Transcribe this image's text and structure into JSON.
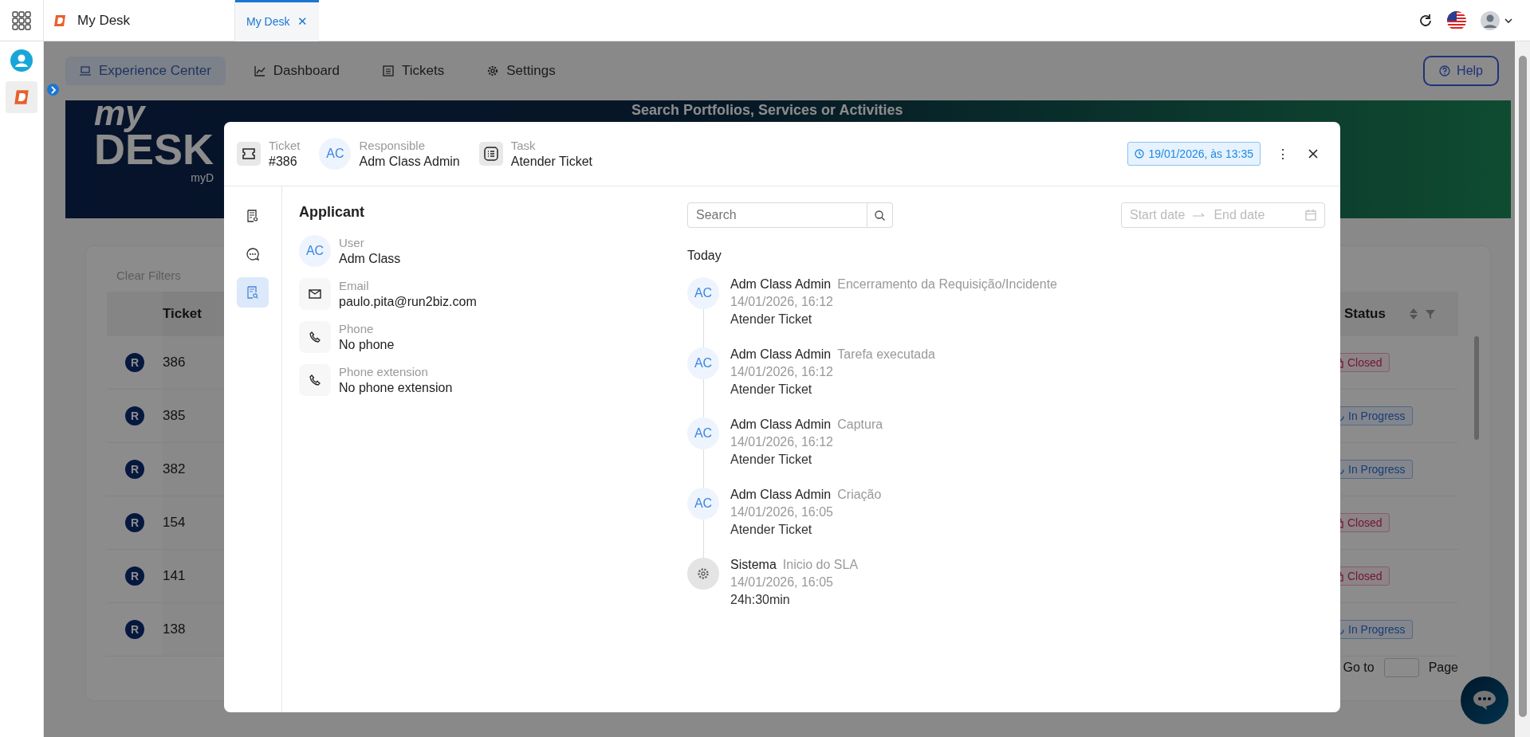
{
  "app_bar": {
    "title": "My Desk",
    "tabs": [
      {
        "label": "My Desk",
        "selected": true,
        "close": "✕"
      }
    ]
  },
  "nav": {
    "items": [
      {
        "label": "Experience Center",
        "selected": true
      },
      {
        "label": "Dashboard",
        "selected": false
      },
      {
        "label": "Tickets",
        "selected": false
      },
      {
        "label": "Settings",
        "selected": false
      }
    ],
    "help": "Help"
  },
  "banner": {
    "logo_top": "my",
    "logo_main": "DESK",
    "logo_sub": "myD",
    "heading": "Search Portfolios, Services or Activities"
  },
  "table": {
    "clear_filters": "Clear Filters",
    "columns": [
      "Ticket",
      "Status"
    ],
    "rows": [
      {
        "badge": "R",
        "ticket": "386",
        "status": "Closed",
        "kind": "closed"
      },
      {
        "badge": "R",
        "ticket": "385",
        "status": "In Progress",
        "kind": "progress"
      },
      {
        "badge": "R",
        "ticket": "382",
        "status": "In Progress",
        "kind": "progress"
      },
      {
        "badge": "R",
        "ticket": "154",
        "status": "Closed",
        "kind": "closed"
      },
      {
        "badge": "R",
        "ticket": "141",
        "status": "Closed",
        "kind": "closed"
      },
      {
        "badge": "R",
        "ticket": "138",
        "status": "In Progress",
        "kind": "progress"
      }
    ],
    "pagination": {
      "go_to": "Go to",
      "page": "Page"
    }
  },
  "modal": {
    "header": {
      "ticket_label": "Ticket",
      "ticket": "#386",
      "responsible_label": "Responsible",
      "responsible_initials": "AC",
      "responsible": "Adm Class Admin",
      "task_label": "Task",
      "task": "Atender Ticket",
      "date": "19/01/2026, às 13:35",
      "menu": "⋮"
    },
    "side_tabs": [
      {
        "selected": false
      },
      {
        "selected": false
      },
      {
        "selected": true
      }
    ],
    "applicant": {
      "title": "Applicant",
      "fields": [
        {
          "kind": "avatar",
          "initials": "AC",
          "label": "User",
          "value": "Adm Class"
        },
        {
          "kind": "email",
          "label": "Email",
          "value": "paulo.pita@run2biz.com"
        },
        {
          "kind": "phone",
          "label": "Phone",
          "value": "No phone"
        },
        {
          "kind": "phone",
          "label": "Phone extension",
          "value": "No phone extension"
        }
      ]
    },
    "search": {
      "placeholder": "Search"
    },
    "date_range": {
      "start": "Start date",
      "end": "End date"
    },
    "timeline": {
      "group": "Today",
      "events": [
        {
          "kind": "user",
          "initials": "AC",
          "name": "Adm Class Admin",
          "action": "Encerramento da Requisição/Incidente",
          "time": "14/01/2026, 16:12",
          "detail": "Atender Ticket"
        },
        {
          "kind": "user",
          "initials": "AC",
          "name": "Adm Class Admin",
          "action": "Tarefa executada",
          "time": "14/01/2026, 16:12",
          "detail": "Atender Ticket"
        },
        {
          "kind": "user",
          "initials": "AC",
          "name": "Adm Class Admin",
          "action": "Captura",
          "time": "14/01/2026, 16:12",
          "detail": "Atender Ticket"
        },
        {
          "kind": "user",
          "initials": "AC",
          "name": "Adm Class Admin",
          "action": "Criação",
          "time": "14/01/2026, 16:05",
          "detail": "Atender Ticket"
        },
        {
          "kind": "system",
          "name": "Sistema",
          "action": "Inicio do SLA",
          "time": "14/01/2026, 16:05",
          "detail": "24h:30min"
        }
      ]
    }
  }
}
